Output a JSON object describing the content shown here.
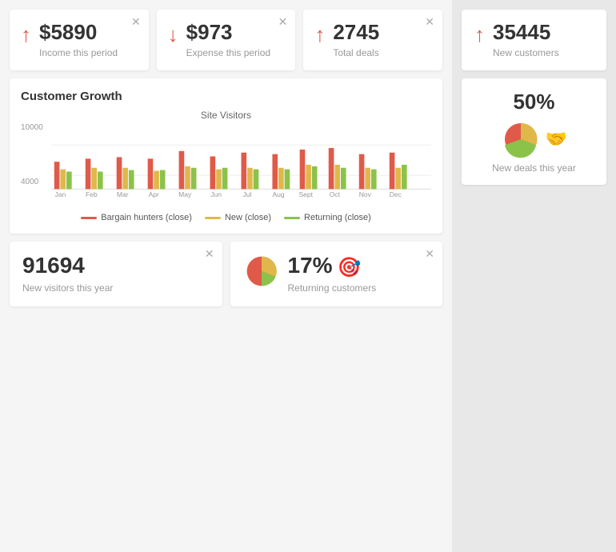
{
  "topCards": [
    {
      "id": "income",
      "value": "$5890",
      "label": "Income this period",
      "arrowDir": "up",
      "closeVisible": true
    },
    {
      "id": "expense",
      "value": "$973",
      "label": "Expense this period",
      "arrowDir": "down",
      "closeVisible": true
    },
    {
      "id": "deals",
      "value": "2745",
      "label": "Total deals",
      "arrowDir": "up",
      "closeVisible": true
    }
  ],
  "chartSection": {
    "title": "Customer Growth",
    "innerTitle": "Site Visitors",
    "yLabels": [
      "4000",
      "10000"
    ],
    "xLabels": [
      "Jan",
      "Feb",
      "Mar",
      "Apr",
      "May",
      "Jun",
      "Jul",
      "Aug",
      "Sept",
      "Oct",
      "Nov",
      "Dec"
    ],
    "legend": [
      {
        "label": "Bargain hunters (close)",
        "color": "#e05a4a"
      },
      {
        "label": "New (close)",
        "color": "#e0b84a"
      },
      {
        "label": "Returning (close)",
        "color": "#8bc34a"
      }
    ]
  },
  "bottomCards": [
    {
      "id": "visitors",
      "value": "91694",
      "label": "New visitors this year",
      "closeVisible": true
    },
    {
      "id": "returning",
      "pct": "17%",
      "label": "Returning customers",
      "closeVisible": true
    }
  ],
  "rightCards": [
    {
      "id": "newCustomers",
      "value": "35445",
      "label": "New customers",
      "arrowDir": "up"
    },
    {
      "id": "newDeals",
      "pct": "50%",
      "label": "New deals this year"
    }
  ],
  "icons": {
    "close": "✕",
    "arrowUp": "↑",
    "arrowDown": "↓",
    "handshake": "🤝",
    "target": "🎯"
  }
}
